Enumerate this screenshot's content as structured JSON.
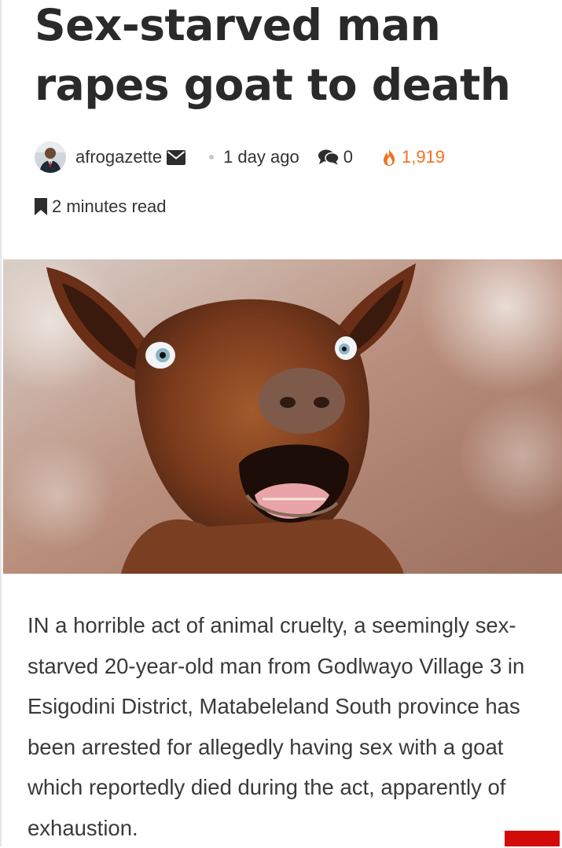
{
  "article": {
    "title": "Sex-starved man rapes goat to death",
    "author": "afrogazette",
    "published": "1 day ago",
    "comments": "0",
    "views": "1,919",
    "read_time": "2 minutes read",
    "body": "IN a horrible act of animal cruelty, a seemingly sex-starved 20-year-old man from Godlwayo Village 3 in Esigodini District, Matabeleland South province has been arrested for allegedly having sex with a goat which reportedly died during the act, apparently of exhaustion."
  },
  "icons": {
    "mail": "envelope-icon",
    "comment": "comments-icon",
    "views": "fire-icon",
    "read_time": "bookmark-icon"
  },
  "colors": {
    "views_accent": "#f37021",
    "bottom_bar": "#d10a0a",
    "title_text": "#2a2a2a",
    "body_text": "#3a3a3a"
  }
}
